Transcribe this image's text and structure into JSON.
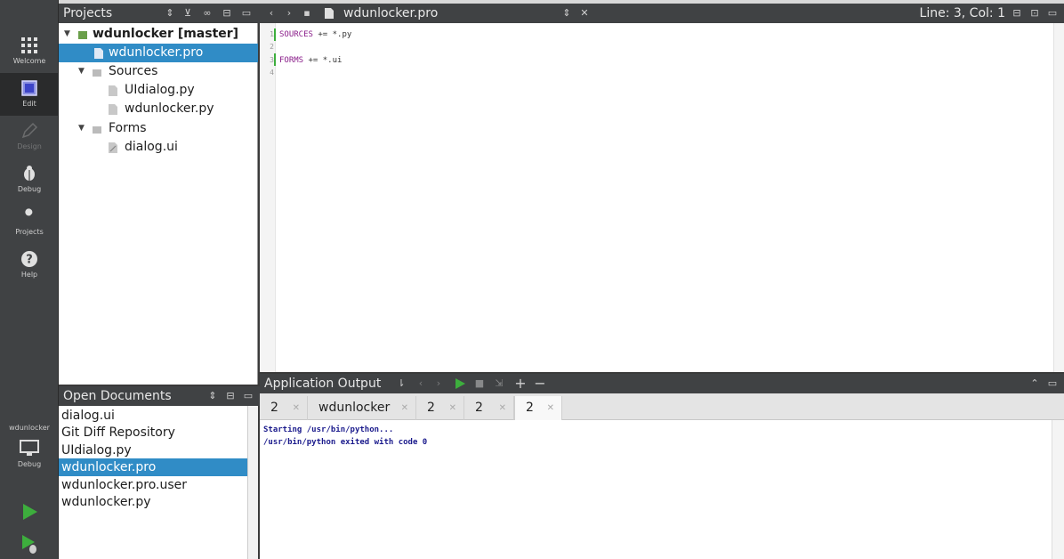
{
  "modes": [
    {
      "name": "welcome",
      "label": "Welcome",
      "icon": "grid-icon"
    },
    {
      "name": "edit",
      "label": "Edit",
      "icon": "edit-icon"
    },
    {
      "name": "design",
      "label": "Design",
      "icon": "pencil-icon"
    },
    {
      "name": "debug",
      "label": "Debug",
      "icon": "bug-icon"
    },
    {
      "name": "projects",
      "label": "Projects",
      "icon": "wrench-icon"
    },
    {
      "name": "help",
      "label": "Help",
      "icon": "help-icon"
    }
  ],
  "kit": {
    "project": "wdunlocker",
    "label": "Debug"
  },
  "projects_panel": {
    "title": "Projects"
  },
  "tree": {
    "root": "wdunlocker [master]",
    "pro_file": "wdunlocker.pro",
    "sources_folder": "Sources",
    "sources": [
      "UIdialog.py",
      "wdunlocker.py"
    ],
    "forms_folder": "Forms",
    "forms": [
      "dialog.ui"
    ]
  },
  "editor": {
    "file_name": "wdunlocker.pro",
    "position": "Line: 3, Col: 1",
    "line_numbers": [
      "1",
      "2",
      "3",
      "4"
    ],
    "lines": [
      {
        "keyword": "SOURCES",
        "rest": " += *.py"
      },
      {
        "keyword": "",
        "rest": ""
      },
      {
        "keyword": "FORMS",
        "rest": " += *.ui"
      },
      {
        "keyword": "",
        "rest": ""
      }
    ]
  },
  "open_documents": {
    "title": "Open Documents",
    "items": [
      "dialog.ui",
      "Git Diff Repository",
      "UIdialog.py",
      "wdunlocker.pro",
      "wdunlocker.pro.user",
      "wdunlocker.py"
    ],
    "selected_index": 3
  },
  "output": {
    "title": "Application Output",
    "tabs": [
      "2",
      "wdunlocker",
      "2",
      "2",
      "2"
    ],
    "active_tab": 4,
    "lines": [
      "Starting /usr/bin/python...",
      "/usr/bin/python exited with code 0"
    ]
  },
  "colors": {
    "selection": "#308cc6",
    "toolbar": "#404244",
    "run": "#3dae3d",
    "output_text": "#1a1a8c"
  }
}
